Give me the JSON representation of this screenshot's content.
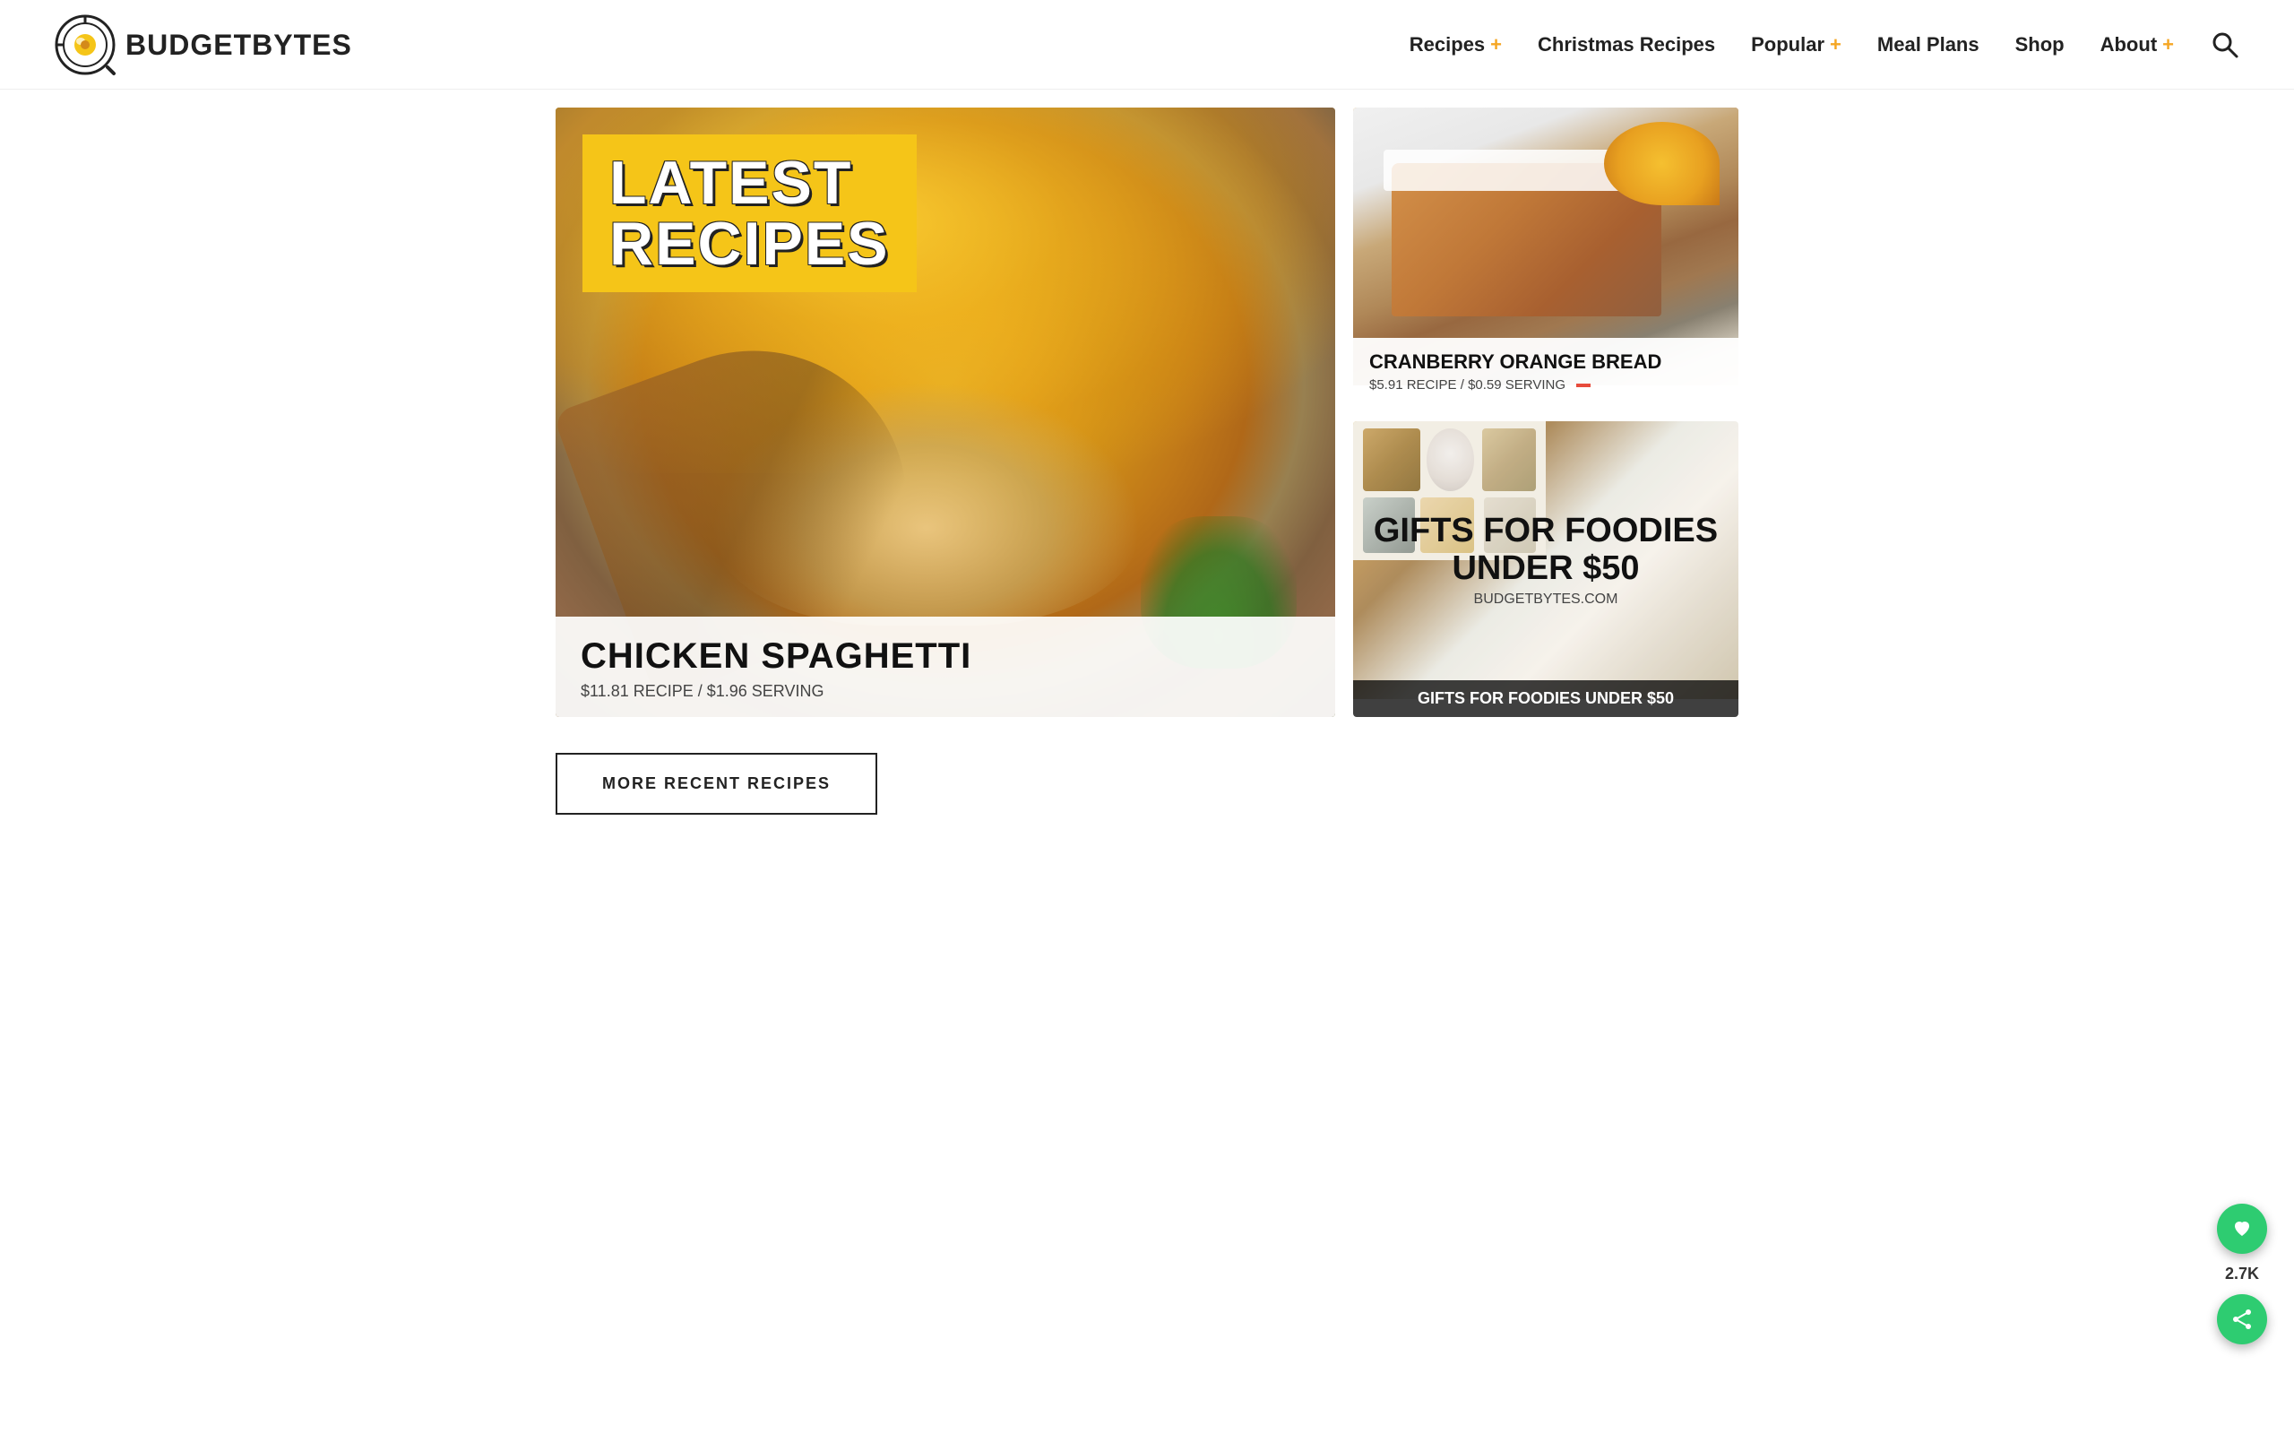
{
  "site": {
    "name": "BUDGETBYTES",
    "name_budget": "BUDGET",
    "name_bytes": "BYTES",
    "logo_alt": "Budget Bytes logo - egg in magnifying glass"
  },
  "nav": {
    "items": [
      {
        "id": "recipes",
        "label": "Recipes",
        "has_plus": true
      },
      {
        "id": "christmas-recipes",
        "label": "Christmas Recipes",
        "has_plus": false
      },
      {
        "id": "popular",
        "label": "Popular",
        "has_plus": true
      },
      {
        "id": "meal-plans",
        "label": "Meal Plans",
        "has_plus": false
      },
      {
        "id": "shop",
        "label": "Shop",
        "has_plus": false
      },
      {
        "id": "about",
        "label": "About",
        "has_plus": true
      }
    ]
  },
  "hero": {
    "badge_line1": "LATEST",
    "badge_line2": "RECIPES",
    "main_recipe": {
      "title": "CHICKEN SPAGHETTI",
      "price_recipe": "$11.81 RECIPE",
      "price_serving": "$1.96 SERVING",
      "price_full": "$11.81 RECIPE / $1.96 SERVING"
    },
    "side_recipe": {
      "title": "CRANBERRY ORANGE BREAD",
      "price_recipe": "$5.91 RECIPE",
      "price_serving": "$0.59 SERVING",
      "price_full": "$5.91 RECIPE / $0.59 SERVING"
    },
    "ad": {
      "main_text": "GIFTS FOR FOODIES UNDER $50",
      "sub_text": "BUDGETBYTES.COM",
      "caption": "GIFTS FOR FOODIES UNDER $50"
    }
  },
  "more_recipes": {
    "button_label": "MORE RECENT RECIPES"
  },
  "fab": {
    "count": "2.7K"
  }
}
